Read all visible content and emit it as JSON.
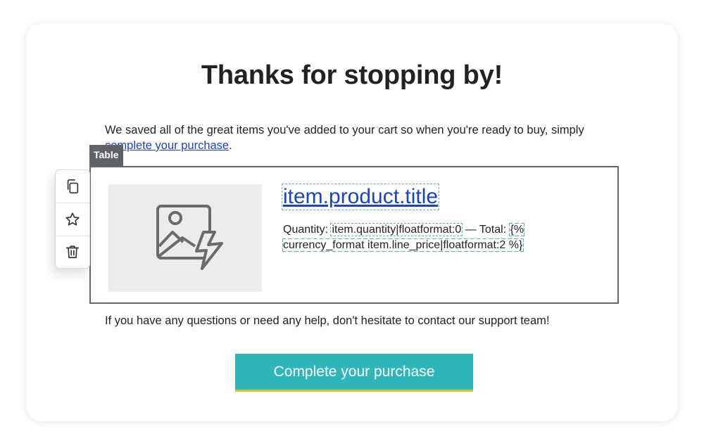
{
  "email": {
    "heading": "Thanks for stopping by!",
    "intro_text": "We saved all of the great items you've added to your cart so when you're ready to buy, simply ",
    "intro_link": "complete your purchase",
    "intro_end": ".",
    "help_text": "If you have any questions or need any help, don't hesitate to contact our support team!",
    "cta_label": "Complete your purchase"
  },
  "block": {
    "label": "Table",
    "product_title": "item.product.title",
    "quantity_label": "Quantity: ",
    "quantity_tag": "item.quantity|floatformat:0",
    "total_label": " — Total: ",
    "total_tag": "{% currency_format item.line_price|floatformat:2 %}"
  },
  "toolbar": {
    "items": [
      {
        "icon": "copy-icon"
      },
      {
        "icon": "star-icon"
      },
      {
        "icon": "trash-icon"
      }
    ]
  },
  "colors": {
    "link": "#1a44c2",
    "cta_background": "#2fb6bb",
    "cta_underline": "#d9c12a",
    "block_border": "#5f6872"
  }
}
